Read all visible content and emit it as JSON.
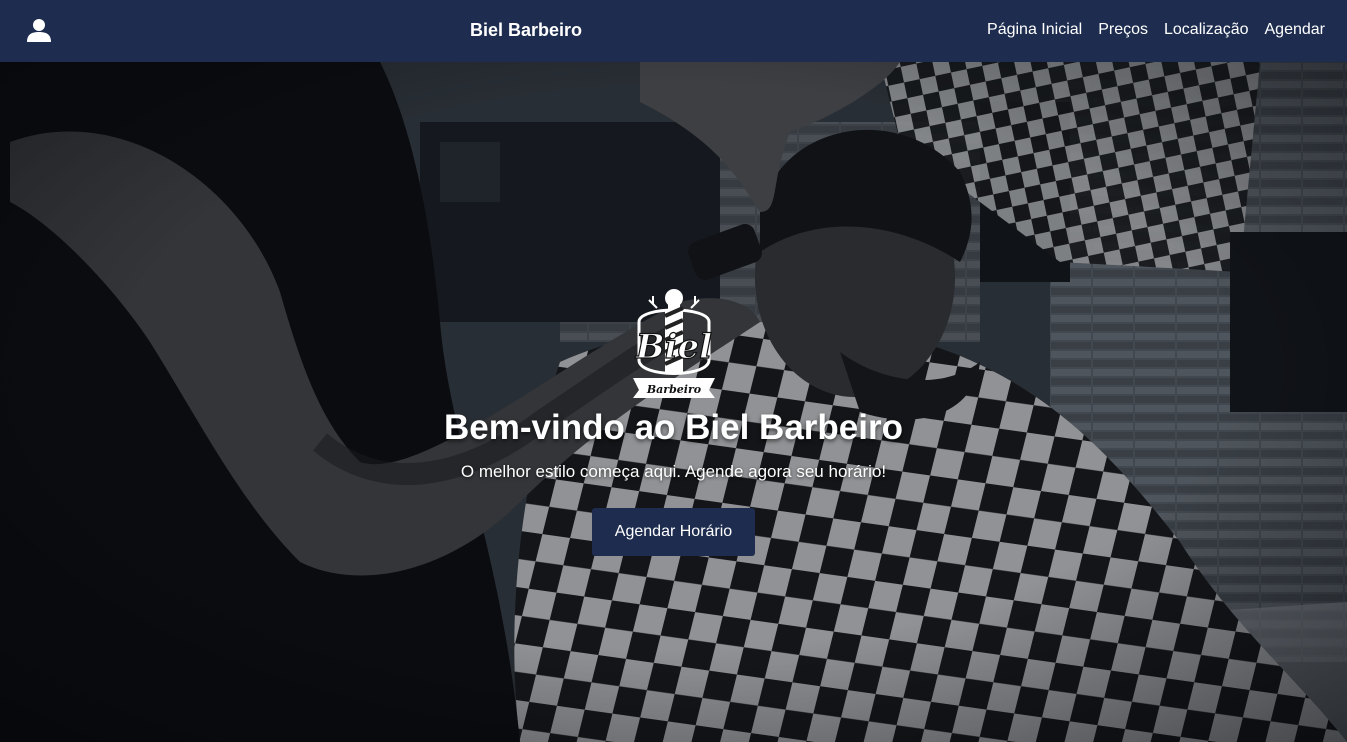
{
  "nav": {
    "brand": "Biel Barbeiro",
    "user_icon": "user-icon",
    "links": [
      "Página Inicial",
      "Preços",
      "Localização",
      "Agendar"
    ]
  },
  "hero": {
    "logo": {
      "line1": "Biel",
      "line2": "Barbeiro"
    },
    "title": "Bem-vindo ao Biel Barbeiro",
    "subtitle": "O melhor estilo começa aqui. Agende agora seu horário!",
    "cta_label": "Agendar Horário",
    "background": "barber-cutting-hair-photo"
  },
  "colors": {
    "navbar": "#1e2d4f",
    "button": "#1e2d4f",
    "text": "#ffffff"
  }
}
